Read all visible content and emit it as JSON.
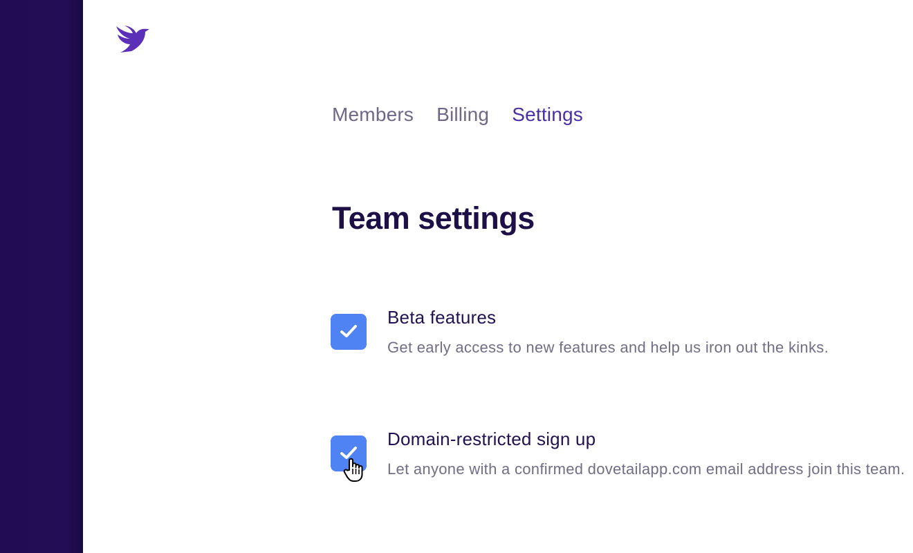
{
  "nav": {
    "tabs": [
      {
        "label": "Members",
        "active": false
      },
      {
        "label": "Billing",
        "active": false
      },
      {
        "label": "Settings",
        "active": true
      }
    ]
  },
  "page": {
    "title": "Team settings"
  },
  "settings": [
    {
      "title": "Beta features",
      "description": "Get early access to new features and help us iron out the kinks.",
      "checked": true
    },
    {
      "title": "Domain-restricted sign up",
      "description": "Let anyone with a confirmed dovetailapp.com email address join this team.",
      "checked": true
    }
  ],
  "icons": {
    "logo": "dovetail-bird-logo-icon",
    "check": "checkmark-icon",
    "cursor": "hand-pointer-cursor-icon"
  },
  "colors": {
    "sidebar": "#210e54",
    "brand": "#4a2fa6",
    "checkbox": "#4f82f3",
    "title": "#1d1046",
    "muted": "#726d85"
  }
}
